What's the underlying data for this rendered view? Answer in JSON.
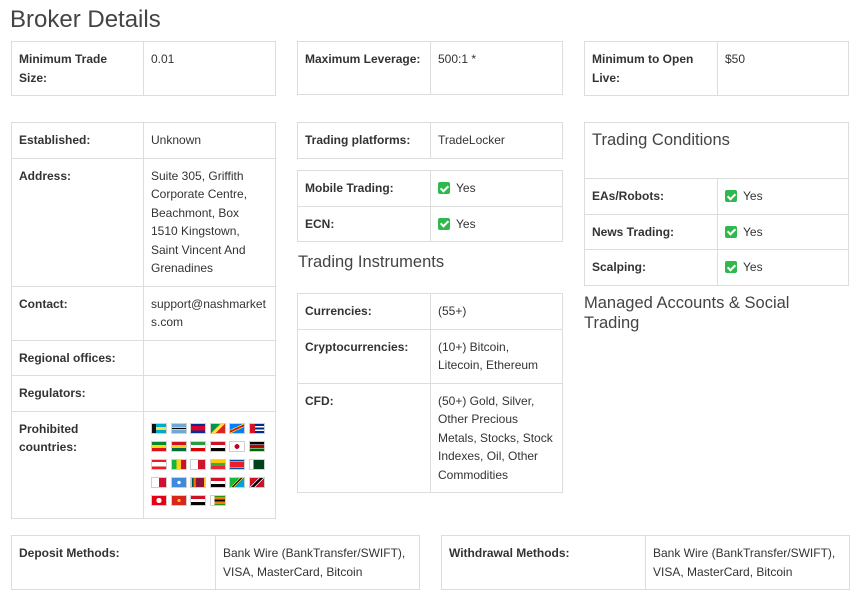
{
  "page_title": "Broker Details",
  "summary": [
    {
      "label": "Minimum Trade Size:",
      "value": "0.01"
    },
    {
      "label": "Maximum Leverage:",
      "value": "500:1 *"
    },
    {
      "label": "Minimum to Open Live:",
      "value": "$50"
    }
  ],
  "company": {
    "established_label": "Established:",
    "established": "Unknown",
    "address_label": "Address:",
    "address": "Suite 305, Griffith Corporate Centre, Beachmont, Box 1510 Kingstown, Saint Vincent And Grenadines",
    "contact_label": "Contact:",
    "contact": "support@nashmarkets.com",
    "regional_label": "Regional offices:",
    "regional": "",
    "regulators_label": "Regulators:",
    "regulators": "",
    "prohibited_label": "Prohibited countries:"
  },
  "platforms": {
    "trading_platforms_label": "Trading platforms:",
    "trading_platforms": "TradeLocker",
    "mobile_label": "Mobile Trading:",
    "mobile": "Yes",
    "ecn_label": "ECN:",
    "ecn": "Yes"
  },
  "instruments": {
    "title": "Trading Instruments",
    "rows": [
      {
        "label": "Currencies:",
        "value": "(55+)"
      },
      {
        "label": "Cryptocurrencies:",
        "value": "(10+) Bitcoin, Litecoin, Ethereum"
      },
      {
        "label": "CFD:",
        "value": "(50+) Gold, Silver, Other Precious Metals, Stocks, Stock Indexes, Oil, Other Commodities"
      }
    ]
  },
  "conditions": {
    "title": "Trading Conditions",
    "rows": [
      {
        "label": "EAs/Robots:",
        "value": "Yes"
      },
      {
        "label": "News Trading:",
        "value": "Yes"
      },
      {
        "label": "Scalping:",
        "value": "Yes"
      }
    ]
  },
  "managed_title": "Managed Accounts & Social Trading",
  "deposit": {
    "label": "Deposit Methods:",
    "value": "Bank Wire (BankTransfer/SWIFT), VISA, MasterCard, Bitcoin"
  },
  "withdrawal": {
    "label": "Withdrawal Methods:",
    "value": "Bank Wire (BankTransfer/SWIFT), VISA, MasterCard, Bitcoin"
  },
  "colors": {
    "check": "#2fb84b",
    "border": "#dddddd"
  },
  "flags": [
    "bahamas",
    "botswana",
    "cambodia",
    "congo",
    "dr-congo",
    "cuba",
    "ethiopia",
    "ghana",
    "iran",
    "iraq",
    "japan",
    "kenya",
    "lebanon",
    "mali",
    "malta",
    "myanmar",
    "north-korea",
    "pakistan",
    "panama",
    "somalia",
    "sri-lanka",
    "syria",
    "tanzania",
    "trinidad-and-tobago",
    "tunisia",
    "vietnam",
    "yemen",
    "zimbabwe"
  ]
}
